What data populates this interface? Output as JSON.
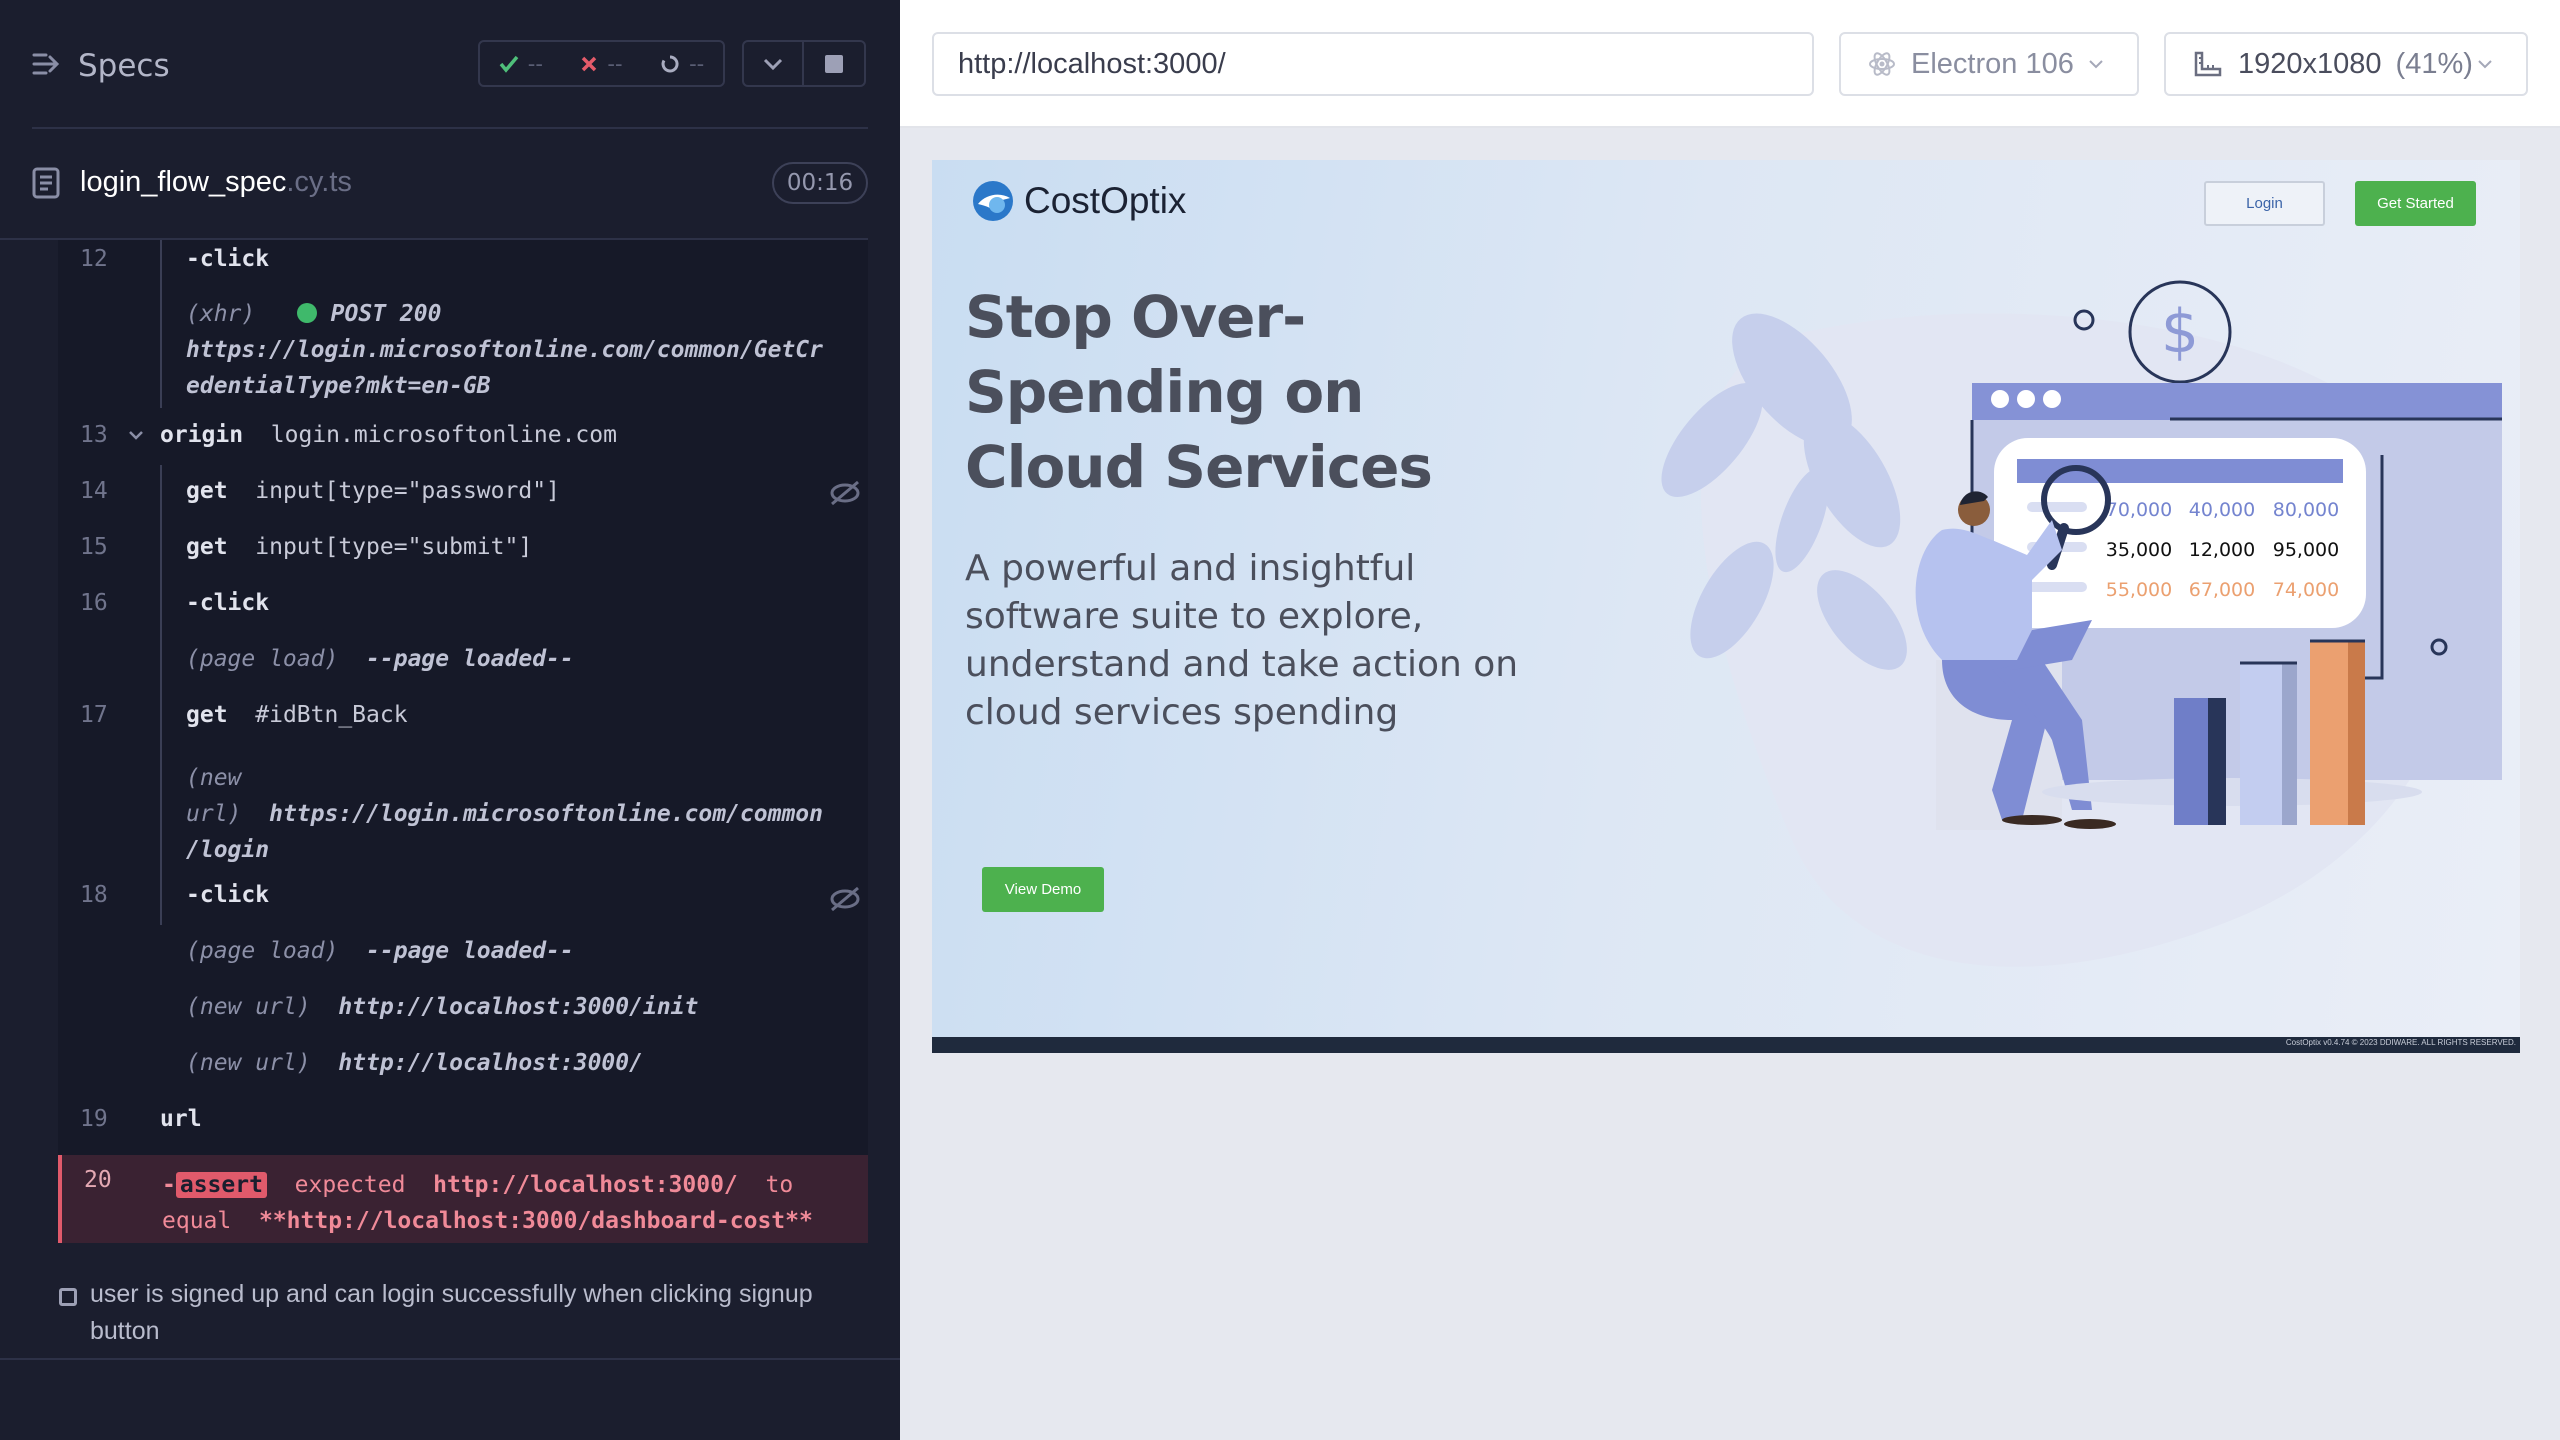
{
  "runner": {
    "specs_title": "Specs",
    "stats": {
      "passed": "--",
      "failed": "--",
      "pending": "--"
    },
    "file": {
      "name": "login_flow_spec",
      "ext": ".cy.ts",
      "duration": "00:16"
    }
  },
  "log": {
    "rows": [
      {
        "num": "12",
        "cmd": "-click"
      },
      {
        "prefix": "(xhr)",
        "method": "POST 200",
        "url_line1": "https://login.microsoftonline.com/common/GetCr",
        "url_line2": "edentialType?mkt=en-GB"
      },
      {
        "num": "13",
        "cmd": "origin",
        "arg": "login.microsoftonline.com"
      },
      {
        "num": "14",
        "cmd": "get",
        "arg": "input[type=\"password\"]"
      },
      {
        "num": "15",
        "cmd": "get",
        "arg": "input[type=\"submit\"]"
      },
      {
        "num": "16",
        "cmd": "-click"
      },
      {
        "prefix": "(page load)",
        "text": "--page loaded--"
      },
      {
        "num": "17",
        "cmd": "get",
        "arg": "#idBtn_Back"
      },
      {
        "prefix_line1": "(new",
        "prefix_line2": "url)",
        "url_line1": "https://login.microsoftonline.com/common",
        "url_line2": "/login"
      },
      {
        "num": "18",
        "cmd": "-click"
      },
      {
        "prefix": "(page load)",
        "text": "--page loaded--"
      },
      {
        "prefix": "(new url)",
        "text": "http://localhost:3000/init"
      },
      {
        "prefix": "(new url)",
        "text": "http://localhost:3000/"
      },
      {
        "num": "19",
        "cmd": "url"
      }
    ],
    "error": {
      "num": "20",
      "dash": "-",
      "badge": "assert",
      "expected": "expected",
      "actual": "http://localhost:3000/",
      "to": "to",
      "equal": "equal",
      "target": "**http://localhost:3000/dashboard-cost**"
    }
  },
  "test": {
    "title": "user is signed up and can login successfully when clicking signup button"
  },
  "browser": {
    "url": "http://localhost:3000/",
    "engine": "Electron 106",
    "viewport": "1920x1080",
    "zoom": "(41%)"
  },
  "app": {
    "logo": "CostOptix",
    "login": "Login",
    "get_started": "Get Started",
    "hero_title": "Stop Over-Spending on Cloud Services",
    "hero_sub": "A powerful and insightful software suite to explore, understand and take action on cloud services spending",
    "view_demo": "View Demo",
    "footer": "CostOptix v0.4.74 © 2023 DDIWARE. ALL RIGHTS RESERVED.",
    "table": [
      [
        "70,000",
        "40,000",
        "80,000"
      ],
      [
        "35,000",
        "12,000",
        "95,000"
      ],
      [
        "55,000",
        "67,000",
        "74,000"
      ]
    ],
    "colors": {
      "accent_green": "#4db14e",
      "row1": "#7484cf",
      "row2": "#111111",
      "row3": "#eba070"
    }
  }
}
